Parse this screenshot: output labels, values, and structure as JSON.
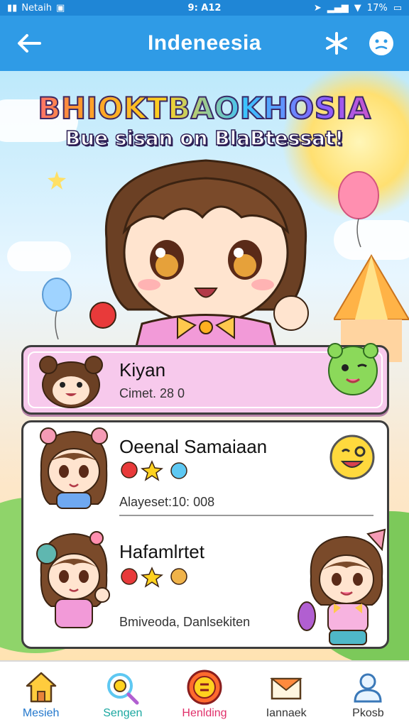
{
  "status_bar": {
    "carrier": "Netaih",
    "time": "9: A12",
    "battery": "17%"
  },
  "app_bar": {
    "title": "Indeneesia",
    "back_icon": "arrow-left-icon",
    "star_icon": "sparkle-icon",
    "profile_icon": "face-icon"
  },
  "banner": {
    "headline": "BHIOKTBAOKHOSIA",
    "subheadline": "Bue sisan on BlaBtessat!"
  },
  "top_card": {
    "name": "Kiyan",
    "detail": "Cimet. 28 0"
  },
  "main_card": {
    "entry1": {
      "name": "Oeenal Samaiaan",
      "detail": "Alayeset:10: 008"
    },
    "entry2": {
      "name": "Hafamlrtet",
      "detail": "Bmiveoda, Danlsekiten"
    }
  },
  "bottom_nav": {
    "items": [
      {
        "label": "Mesieh",
        "icon": "home-icon",
        "color": "#2277cc"
      },
      {
        "label": "Sengen",
        "icon": "lollipop-icon",
        "color": "#1aa7a0"
      },
      {
        "label": "Henlding",
        "icon": "coin-icon",
        "color": "#e0306a"
      },
      {
        "label": "Iannaek",
        "icon": "envelope-icon",
        "color": "#333333"
      },
      {
        "label": "Pkosb",
        "icon": "person-icon",
        "color": "#333333"
      }
    ]
  },
  "colors": {
    "app_bar": "#2f9be6",
    "status_bar": "#1f86d6",
    "top_card": "#f7c9ec"
  }
}
